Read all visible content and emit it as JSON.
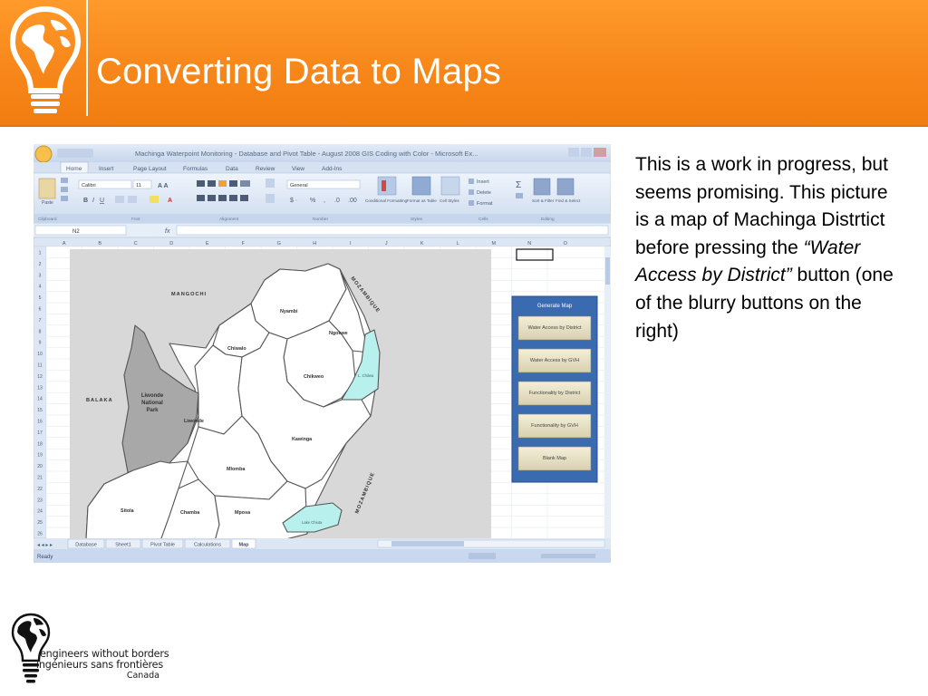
{
  "slide": {
    "title": "Converting Data to Maps",
    "description": {
      "part1": "This is a work in progress, but seems promising. This picture is a map of Machinga Distrtict before pressing the ",
      "italic": "“Water Access by District”",
      "part2": " button (one of the blurry buttons on the right)"
    }
  },
  "excel": {
    "title_bar": "Machinga Waterpoint Monitoring - Database and Pivot Table - August 2008 GIS Coding with Color - Microsoft Ex...",
    "ribbon_tabs": [
      "Home",
      "Insert",
      "Page Layout",
      "Formulas",
      "Data",
      "Review",
      "View",
      "Add-Ins"
    ],
    "name_box": "N2",
    "font_name": "Calibri",
    "font_size": "11",
    "number_format": "General",
    "ribbon_groups": [
      "Clipboard",
      "Font",
      "Alignment",
      "Number",
      "Styles",
      "Cells",
      "Editing"
    ],
    "ribbon_buttons": {
      "paste": "Paste",
      "conditional_formatting": "Conditional Formatting",
      "format_as_table": "Format as Table",
      "cell_styles": "Cell Styles",
      "insert": "Insert",
      "delete": "Delete",
      "format": "Format",
      "sort_filter": "Sort & Filter",
      "find_select": "Find & Select"
    },
    "columns": [
      "A",
      "B",
      "C",
      "D",
      "E",
      "F",
      "G",
      "H",
      "I",
      "J",
      "K",
      "L",
      "M",
      "N",
      "O"
    ],
    "rows": [
      "1",
      "2",
      "3",
      "4",
      "5",
      "6",
      "7",
      "8",
      "9",
      "10",
      "11",
      "12",
      "13",
      "14",
      "15",
      "16",
      "17",
      "18",
      "19",
      "20",
      "21",
      "22",
      "23",
      "24",
      "25",
      "26"
    ],
    "sheet_tabs": [
      "Database",
      "Sheet1",
      "Pivot Table",
      "Calculations",
      "Map"
    ],
    "active_sheet": "Map",
    "status": "Ready",
    "macro_panel": {
      "header": "Generate Map",
      "buttons": [
        "Water Access by District",
        "Water Access by GVH",
        "Functionality by District",
        "Functionality by GVH",
        "Blank Map"
      ]
    },
    "map_labels": {
      "neighbors": [
        "MANGOCHI",
        "BALAKA",
        "MOZAMBIQUE",
        "MOZAMBIQUE"
      ],
      "park": "Liwonde National Park",
      "districts": [
        "Nyambi",
        "Ngokwe",
        "Chiwalo",
        "Chikweo",
        "Liwonde",
        "Kawinga",
        "Mlomba",
        "Sitola",
        "Chamba",
        "Mposa"
      ],
      "lakes": [
        "L. Chilwa",
        "Lake Chiuta"
      ]
    },
    "map_colors": {
      "district_fill": "#ffffff",
      "park_fill": "#a8a8a8",
      "lake_fill": "#b8f0ee",
      "background": "#d8d8d8"
    }
  },
  "org": {
    "name_en": "engineers without borders",
    "name_fr": "ingénieurs sans frontières",
    "country": "Canada"
  },
  "colors": {
    "header_orange": "#f7871a",
    "title_text": "#ffffff",
    "body_text": "#000000"
  }
}
